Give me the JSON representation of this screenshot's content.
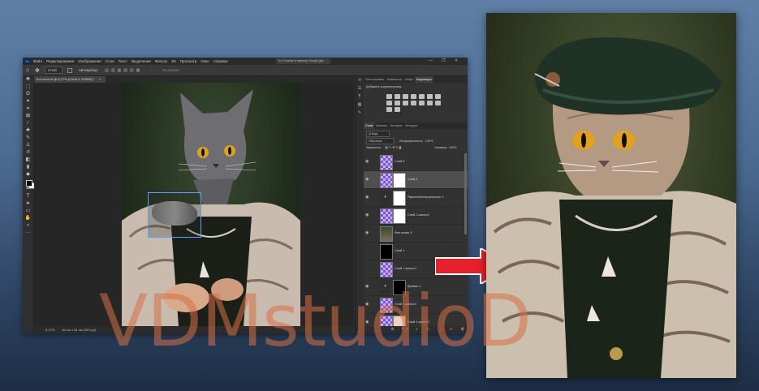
{
  "menubar": {
    "logo": "Ps",
    "items": [
      "Файл",
      "Редактирование",
      "Изображение",
      "Слои",
      "Текст",
      "Выделение",
      "Фильтр",
      "3D",
      "Просмотр",
      "Окно",
      "Справка"
    ],
    "browser_tab": "● ● Ссылки в заметки Google Дис",
    "window_controls": {
      "minimize": "—",
      "maximize": "❐",
      "close": "✕"
    }
  },
  "options_bar": {
    "home_icon": "home-icon",
    "layer_select": "Слой",
    "auto_label": "Автовыбор:",
    "mode_3d": "3D-режим"
  },
  "document": {
    "tab_title": "Кот work.tif @ 8,17% (Слой 4, RGB/8) *",
    "tab_close": "×",
    "zoom": "8,17%",
    "info": "84 см x 84 см (300 ppi)"
  },
  "panels": {
    "tabs_top": [
      "Гистограмма",
      "Навигатор",
      "Инфо",
      "Коррекция"
    ],
    "active_top": "Коррекция",
    "correction_title": "Добавить корректировку",
    "tabs_layers": [
      "Слои",
      "Каналы",
      "История",
      "Контуры"
    ],
    "active_layers": "Слои",
    "kind_label": "Q Вид",
    "blend_mode": "Обычные",
    "opacity_label": "Непрозрачность:",
    "opacity_value": "100%",
    "lock_label": "Закрепить:",
    "fill_label": "Заливка:",
    "fill_value": "100%",
    "layers": [
      {
        "name": "Слой 3",
        "thumb": "checker",
        "mask": false,
        "selected": false,
        "eye": true
      },
      {
        "name": "Слой 4",
        "thumb": "checker",
        "mask": true,
        "mask_color": "#ffffff",
        "selected": true,
        "eye": true
      },
      {
        "name": "Яркость/Контрастность 1",
        "thumb": "adjust",
        "mask": true,
        "mask_color": "#ffffff",
        "selected": false,
        "eye": true
      },
      {
        "name": "Слой 1 копия 6",
        "thumb": "checker",
        "mask": true,
        "mask_color": "#ffffff",
        "selected": false,
        "eye": true
      },
      {
        "name": "Фон копия 3",
        "thumb": "photo",
        "mask": false,
        "selected": false,
        "eye": true
      },
      {
        "name": "Слой 1",
        "thumb": "black",
        "mask": false,
        "selected": false,
        "eye": false
      },
      {
        "name": "Слой 1 копия 5",
        "thumb": "checker",
        "mask": false,
        "selected": false,
        "eye": false
      },
      {
        "name": "Кривые 1",
        "thumb": "adjust",
        "mask": true,
        "mask_color": "#000000",
        "selected": false,
        "eye": true
      },
      {
        "name": "Слой 1 копия 4",
        "thumb": "checker",
        "mask": false,
        "selected": false,
        "eye": true
      },
      {
        "name": "Слой 1 копия 3",
        "thumb": "checker",
        "mask": true,
        "mask_color": "#f0d0c0",
        "selected": false,
        "eye": true
      }
    ],
    "footer_icons": "⊕ fx ◐ ▭ 🗀 ＋ 🗑"
  },
  "watermark": "VDMstudioD",
  "colors": {
    "accent_arrow": "#e8202c",
    "watermark": "#d67046",
    "ps_bg": "#323232"
  }
}
